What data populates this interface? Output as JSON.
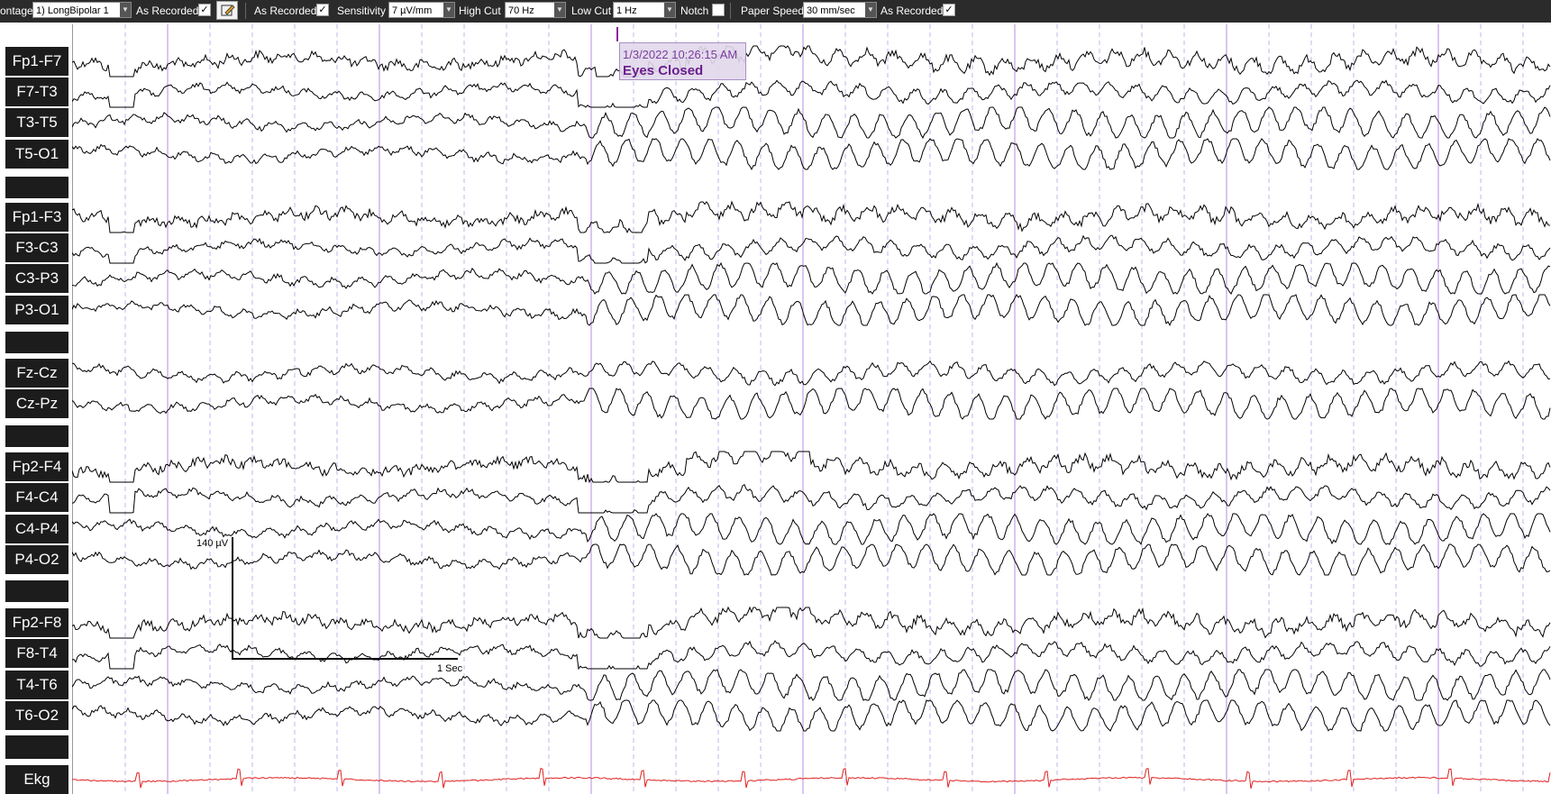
{
  "toolbar": {
    "montage_label": "ontage",
    "montage_value": "1) LongBipolar 1",
    "as_recorded_1": "As Recorded",
    "as_recorded_2": "As Recorded",
    "sensitivity_label": "Sensitivity",
    "sensitivity_value": "7 µV/mm",
    "high_cut_label": "High Cut",
    "high_cut_value": "70 Hz",
    "low_cut_label": "Low Cut",
    "low_cut_value": "1 Hz",
    "notch_label": "Notch",
    "paper_speed_label": "Paper Speed",
    "paper_speed_value": "30 mm/sec",
    "as_recorded_3": "As Recorded",
    "checkbox_mark": "✓"
  },
  "channels": [
    {
      "name": "Fp1-F7"
    },
    {
      "name": "F7-T3"
    },
    {
      "name": "T3-T5"
    },
    {
      "name": "T5-O1"
    },
    {
      "name": "Fp1-F3"
    },
    {
      "name": "F3-C3"
    },
    {
      "name": "C3-P3"
    },
    {
      "name": "P3-O1"
    },
    {
      "name": "Fz-Cz"
    },
    {
      "name": "Cz-Pz"
    },
    {
      "name": "Fp2-F4"
    },
    {
      "name": "F4-C4"
    },
    {
      "name": "C4-P4"
    },
    {
      "name": "P4-O2"
    },
    {
      "name": "Fp2-F8"
    },
    {
      "name": "F8-T4"
    },
    {
      "name": "T4-T6"
    },
    {
      "name": "T6-O2"
    },
    {
      "name": "Ekg"
    }
  ],
  "event": {
    "time": "1/3/2022 10:26:15 AM",
    "label": "Eyes Closed"
  },
  "calibration": {
    "amplitude_label": "140 µV",
    "time_label": "1 Sec"
  },
  "colors": {
    "trace": "#000000",
    "ekg": "#e02020",
    "second_line": "#b48ee0",
    "subsecond_line": "#a8a8e8",
    "event_accent": "#7a2f9a"
  }
}
